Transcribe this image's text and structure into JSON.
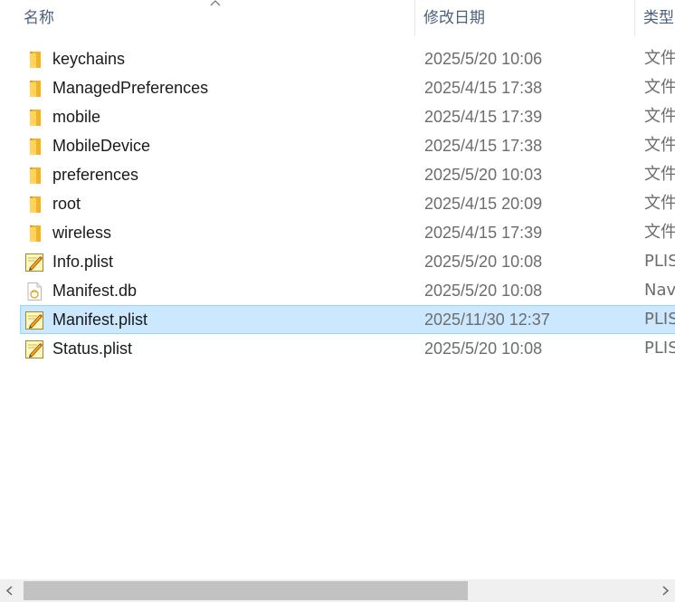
{
  "columns": {
    "name": "名称",
    "date": "修改日期",
    "type": "类型"
  },
  "sort": {
    "column": "name",
    "direction": "ascending",
    "icon": "sort-up-icon"
  },
  "files": [
    {
      "name": "keychains",
      "date": "2025/5/20 10:06",
      "type": "文件",
      "icon": "folder-icon",
      "selected": false
    },
    {
      "name": "ManagedPreferences",
      "date": "2025/4/15 17:38",
      "type": "文件",
      "icon": "folder-icon",
      "selected": false
    },
    {
      "name": "mobile",
      "date": "2025/4/15 17:39",
      "type": "文件",
      "icon": "folder-icon",
      "selected": false
    },
    {
      "name": "MobileDevice",
      "date": "2025/4/15 17:38",
      "type": "文件",
      "icon": "folder-icon",
      "selected": false
    },
    {
      "name": "preferences",
      "date": "2025/5/20 10:03",
      "type": "文件",
      "icon": "folder-icon",
      "selected": false
    },
    {
      "name": "root",
      "date": "2025/4/15 20:09",
      "type": "文件",
      "icon": "folder-icon",
      "selected": false
    },
    {
      "name": "wireless",
      "date": "2025/4/15 17:39",
      "type": "文件",
      "icon": "folder-icon",
      "selected": false
    },
    {
      "name": "Info.plist",
      "date": "2025/5/20 10:08",
      "type": "PLIS",
      "icon": "plist-file-icon",
      "selected": false
    },
    {
      "name": "Manifest.db",
      "date": "2025/5/20 10:08",
      "type": "Nav",
      "icon": "db-file-icon",
      "selected": false
    },
    {
      "name": "Manifest.plist",
      "date": "2025/11/30 12:37",
      "type": "PLIS",
      "icon": "plist-file-icon",
      "selected": true
    },
    {
      "name": "Status.plist",
      "date": "2025/5/20 10:08",
      "type": "PLIS",
      "icon": "plist-file-icon",
      "selected": false
    }
  ],
  "colors": {
    "header_text": "#4c607a",
    "date_text": "#6d6d6d",
    "selection_bg": "#cce8ff",
    "selection_border": "#99d1ff",
    "folder_yellow": "#ffc83d"
  }
}
